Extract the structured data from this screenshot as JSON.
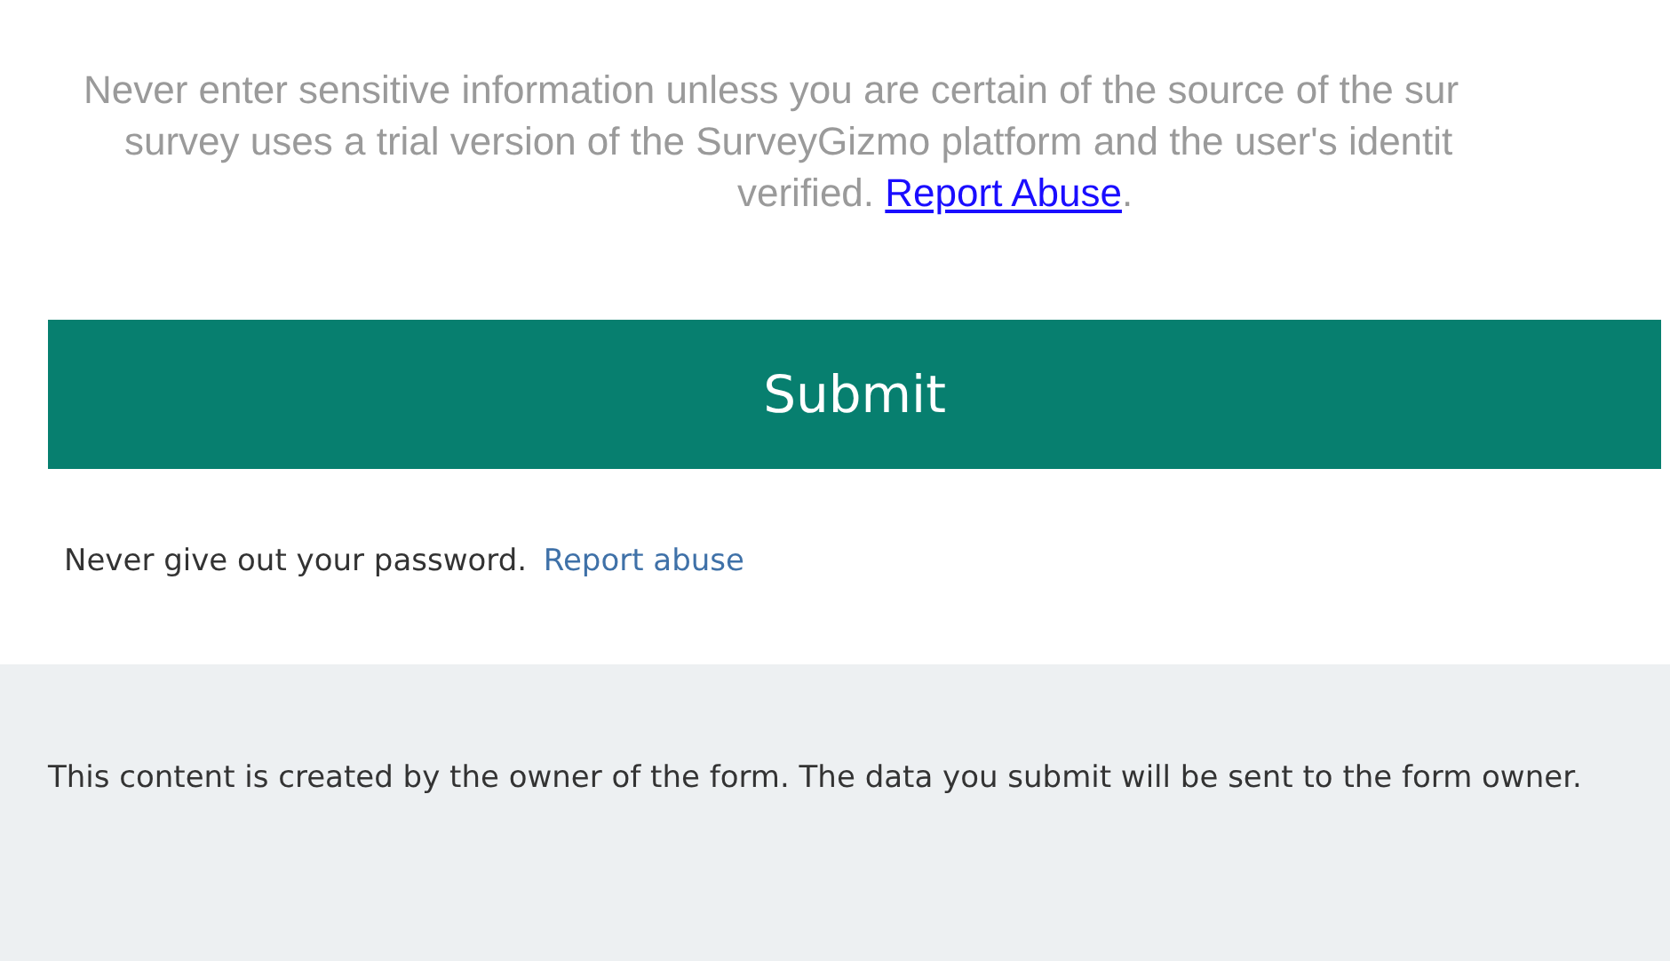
{
  "notice": {
    "lines": [
      "Never enter sensitive information unless you are certain of the source of the sur",
      "survey uses a trial version of the SurveyGizmo platform and the user's identit",
      "verified."
    ],
    "link": "Report Abuse",
    "after_link": "."
  },
  "submit_button": {
    "label": "Submit"
  },
  "password_warning": {
    "text": "Never give out your password.",
    "link": "Report abuse"
  },
  "footer": {
    "text": "This content is created by the owner of the form. The data you submit will be sent to the form owner."
  }
}
